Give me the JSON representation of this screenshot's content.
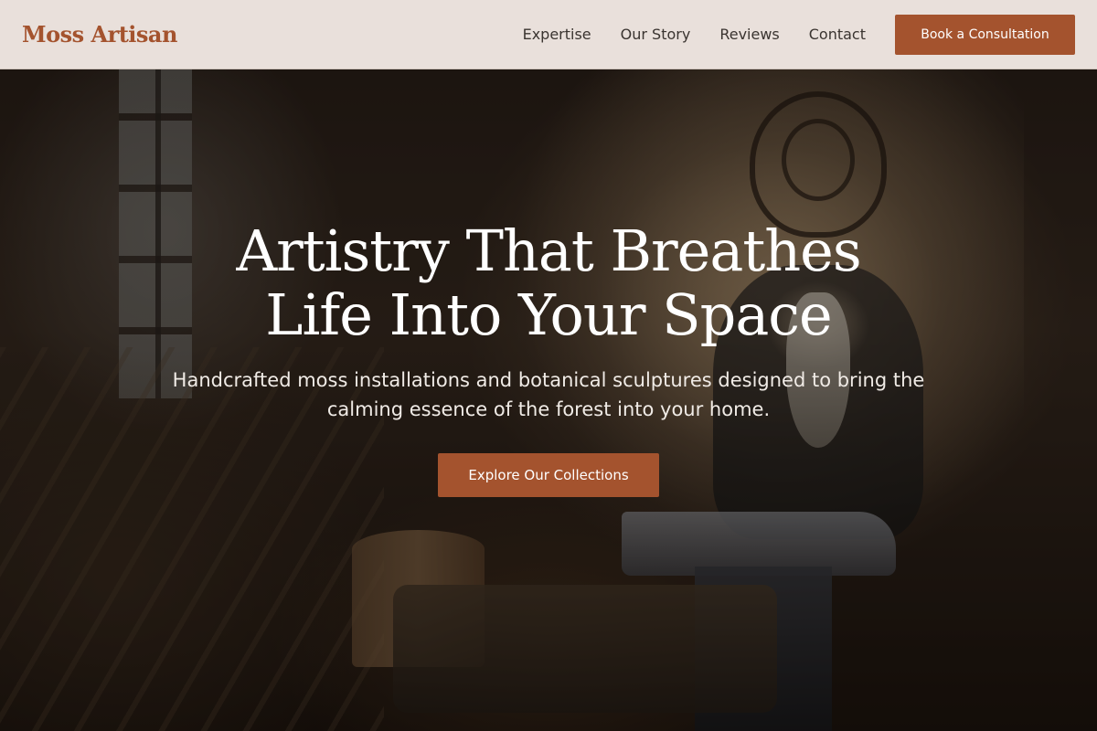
{
  "brand": {
    "logo_text": "Moss Artisan",
    "accent_color": "#a4532e"
  },
  "nav": {
    "links": [
      {
        "label": "Expertise"
      },
      {
        "label": "Our Story"
      },
      {
        "label": "Reviews"
      },
      {
        "label": "Contact"
      }
    ],
    "cta_label": "Book a Consultation"
  },
  "hero": {
    "title_line1": "Artistry That Breathes",
    "title_line2": "Life Into Your Space",
    "subtitle": "Handcrafted moss installations and botanical sculptures designed to bring the calming essence of the forest into your home.",
    "button_label": "Explore Our Collections",
    "background_image": "blacksmith-workshop-photo"
  }
}
